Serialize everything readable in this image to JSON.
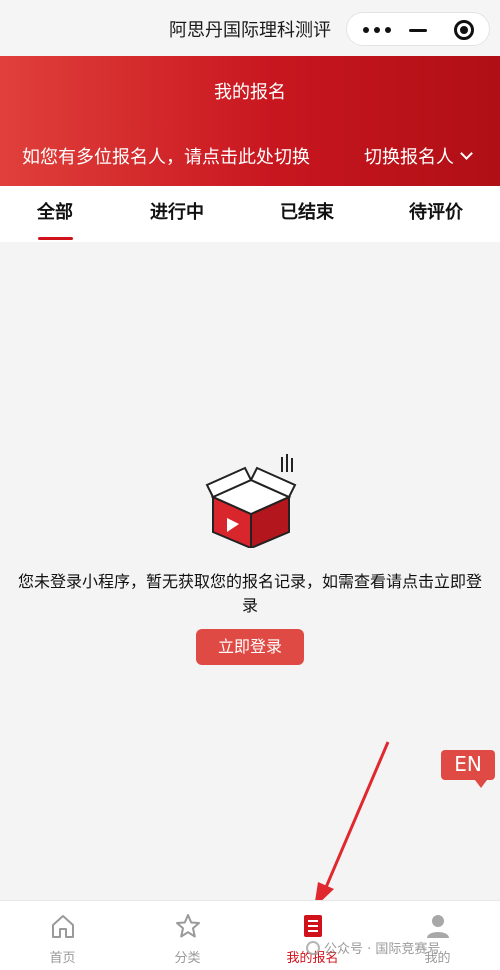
{
  "topbar": {
    "app_title": "阿思丹国际理科测评"
  },
  "banner": {
    "title": "我的报名",
    "switch_hint": "如您有多位报名人，请点击此处切换",
    "switch_label": "切换报名人"
  },
  "tabs": [
    {
      "label": "全部",
      "active": true
    },
    {
      "label": "进行中"
    },
    {
      "label": "已结束"
    },
    {
      "label": "待评价"
    }
  ],
  "empty_state": {
    "message": "您未登录小程序，暂无获取您的报名记录，如需查看请点击立即登录",
    "login_label": "立即登录"
  },
  "lang_badge": "EN",
  "bottom_nav": [
    {
      "label": "首页",
      "icon": "home-icon"
    },
    {
      "label": "分类",
      "icon": "star-icon"
    },
    {
      "label": "我的报名",
      "icon": "list-icon",
      "active": true
    },
    {
      "label": "我的",
      "icon": "user-icon"
    }
  ],
  "watermark": "公众号 · 国际竞赛号",
  "colors": {
    "brand_red": "#d0121b",
    "banner_start": "#e0403b",
    "banner_end": "#b00f16",
    "button_red": "#e04a44"
  }
}
